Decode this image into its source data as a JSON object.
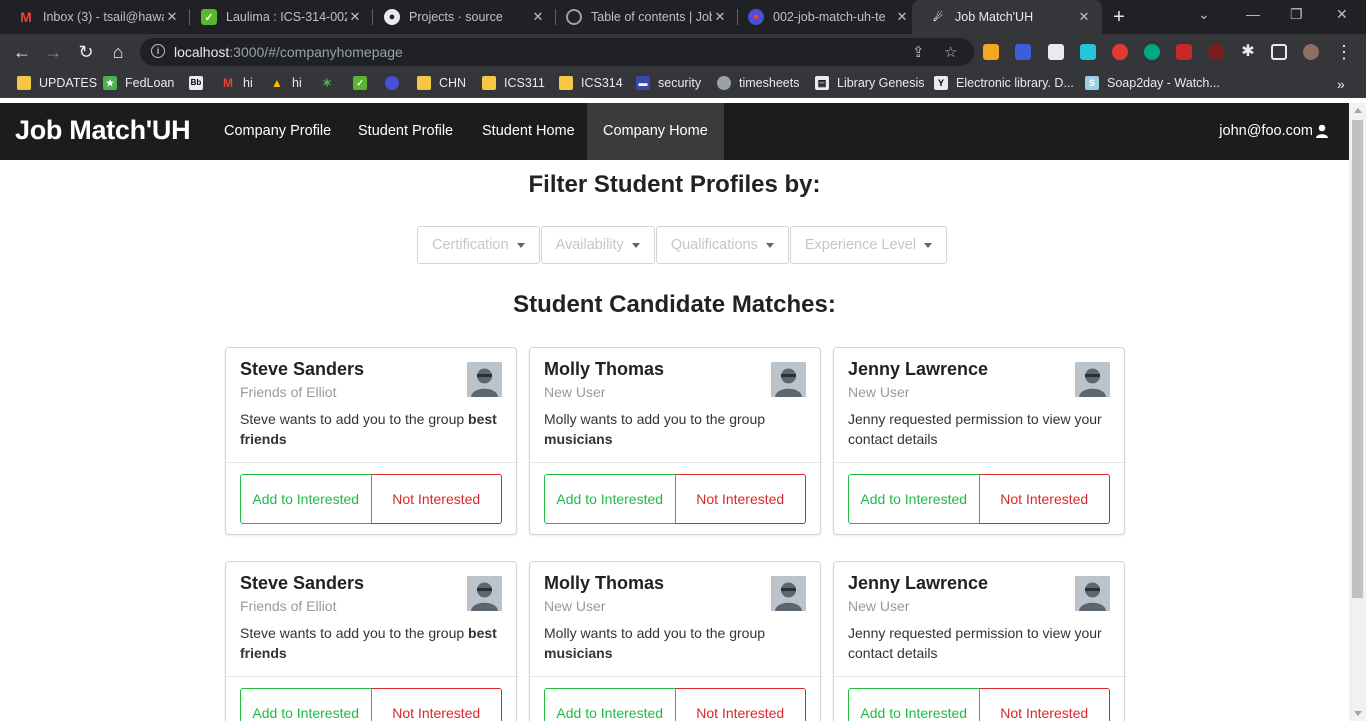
{
  "browser": {
    "tabs": [
      {
        "title": "Inbox (3) - tsail@hawa",
        "icon": "gmail-icon"
      },
      {
        "title": "Laulima : ICS-314-002",
        "icon": "laulima-icon"
      },
      {
        "title": "Projects · source",
        "icon": "github-icon"
      },
      {
        "title": "Table of contents | Job",
        "icon": "globe-icon"
      },
      {
        "title": "002-job-match-uh-te",
        "icon": "app-icon"
      },
      {
        "title": "Job Match'UH",
        "icon": "meteor-icon"
      }
    ],
    "url_host": "localhost",
    "url_rest": ":3000/#/companyhomepage",
    "bookmarks": [
      "UPDATES",
      "FedLoan",
      "",
      "hi",
      "hi",
      "",
      "",
      "",
      "CHN",
      "ICS311",
      "ICS314",
      "security",
      "timesheets",
      "Library Genesis",
      "Electronic library. D...",
      "Soap2day - Watch..."
    ]
  },
  "nav": {
    "brand": "Job Match'UH",
    "items": [
      "Company Profile",
      "Student Profile",
      "Student Home",
      "Company Home"
    ],
    "active": "Company Home",
    "user": "john@foo.com"
  },
  "filter_title": "Filter Student Profiles by:",
  "filters": [
    "Certification",
    "Availability",
    "Qualifications",
    "Experience Level"
  ],
  "matches_title": "Student Candidate Matches:",
  "cards": [
    {
      "name": "Steve Sanders",
      "meta": "Friends of Elliot",
      "desc_prefix": "Steve wants to add you to the group ",
      "desc_bold": "best friends",
      "add_label": "Add to Interested",
      "not_label": "Not Interested"
    },
    {
      "name": "Molly Thomas",
      "meta": "New User",
      "desc_prefix": "Molly wants to add you to the group ",
      "desc_bold": "musicians",
      "add_label": "Add to Interested",
      "not_label": "Not Interested"
    },
    {
      "name": "Jenny Lawrence",
      "meta": "New User",
      "desc_prefix": "Jenny requested permission to view your contact details",
      "desc_bold": "",
      "add_label": "Add to Interested",
      "not_label": "Not Interested"
    },
    {
      "name": "Steve Sanders",
      "meta": "Friends of Elliot",
      "desc_prefix": "Steve wants to add you to the group ",
      "desc_bold": "best friends",
      "add_label": "Add to Interested",
      "not_label": "Not Interested"
    },
    {
      "name": "Molly Thomas",
      "meta": "New User",
      "desc_prefix": "Molly wants to add you to the group ",
      "desc_bold": "musicians",
      "add_label": "Add to Interested",
      "not_label": "Not Interested"
    },
    {
      "name": "Jenny Lawrence",
      "meta": "New User",
      "desc_prefix": "Jenny requested permission to view your contact details",
      "desc_bold": "",
      "add_label": "Add to Interested",
      "not_label": "Not Interested"
    }
  ],
  "colors": {
    "nav_bg": "#1b1c1d",
    "accent_green": "#21ba45",
    "accent_red": "#db2828"
  }
}
